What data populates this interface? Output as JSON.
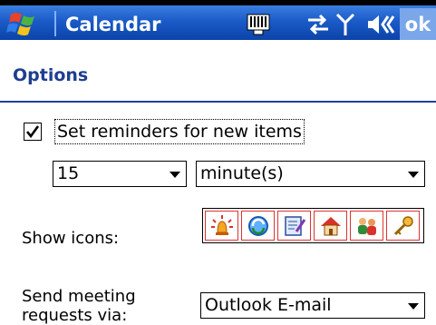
{
  "titlebar": {
    "app_title": "Calendar",
    "ok_label": "ok"
  },
  "options": {
    "title": "Options",
    "reminders": {
      "checked": true,
      "label": "Set reminders for new items"
    },
    "reminder_amount": "15",
    "reminder_unit": "minute(s)",
    "show_icons_label": "Show icons:",
    "icons": [
      "alarm-icon",
      "recurrence-icon",
      "notes-icon",
      "home-icon",
      "attendees-icon",
      "key-icon"
    ],
    "send_label_line1": "Send meeting",
    "send_label_line2": "requests via:",
    "send_via": "Outlook E-mail"
  }
}
